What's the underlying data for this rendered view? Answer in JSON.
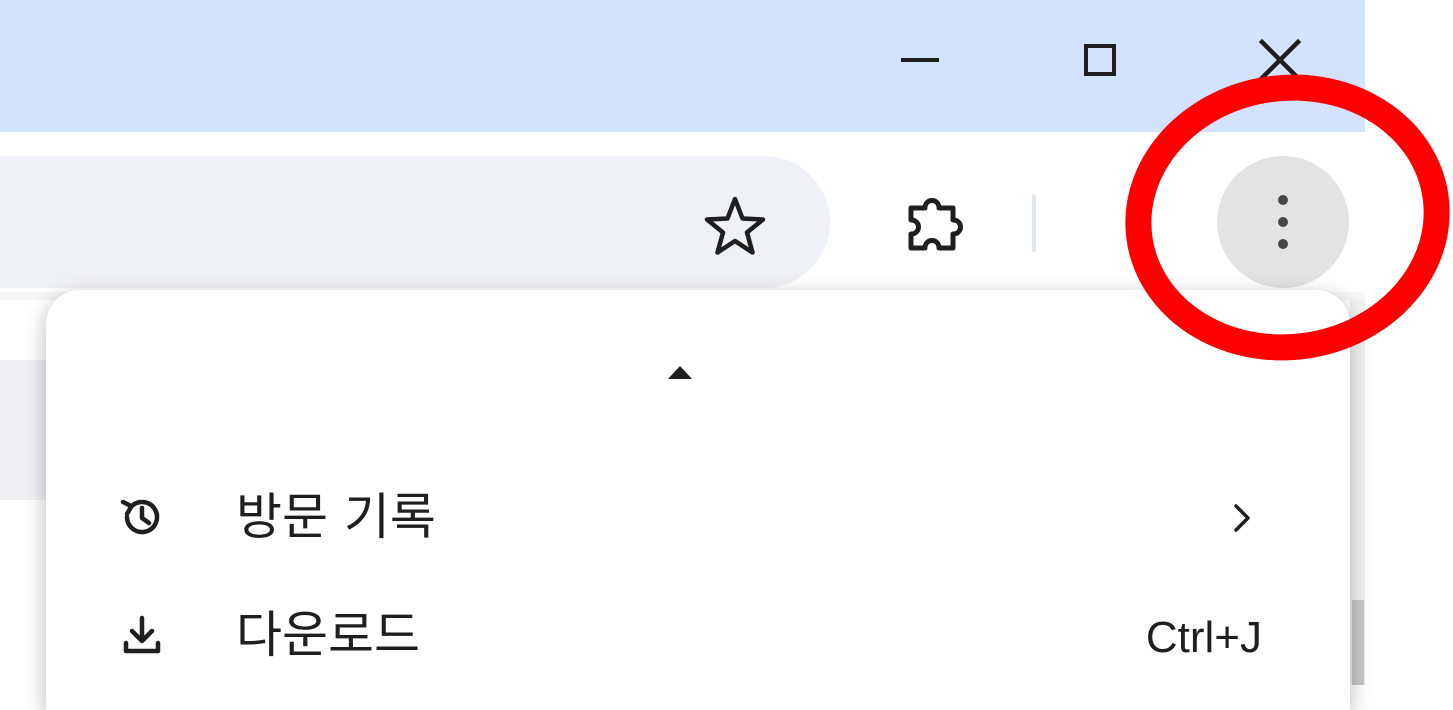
{
  "window_controls": {
    "minimize_icon": "minimize-icon",
    "maximize_icon": "maximize-icon",
    "close_icon": "close-icon"
  },
  "toolbar": {
    "bookmark_icon": "star-icon",
    "extensions_icon": "puzzle-icon",
    "menu_icon": "vertical-dots-icon"
  },
  "menu": {
    "scroll_up_icon": "triangle-up-icon",
    "items": [
      {
        "label": "방문 기록",
        "icon": "history-icon",
        "submenu_icon": "chevron-right-icon",
        "shortcut": ""
      },
      {
        "label": "다운로드",
        "icon": "download-icon",
        "shortcut": "Ctrl+J"
      }
    ]
  },
  "annotation": {
    "shape": "ellipse",
    "color": "#ff0000",
    "target": "menu-button"
  },
  "colors": {
    "titlebar": "#d3e3fd",
    "omnibox": "#eef1f6",
    "menu_button_bg": "#e3e3e3",
    "text": "#1f1f1f"
  }
}
